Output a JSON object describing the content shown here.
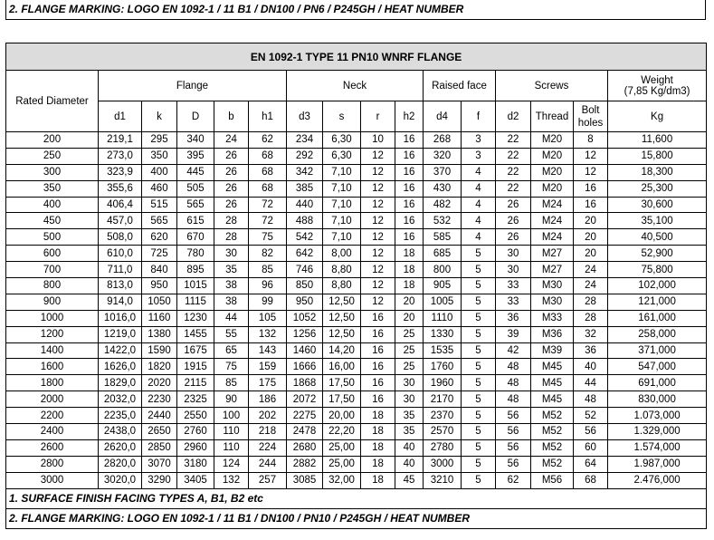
{
  "top_note": "2. FLANGE MARKING: LOGO EN 1092-1 / 11 B1 / DN100 / PN6 / P245GH / HEAT NUMBER",
  "table": {
    "title": "EN 1092-1 TYPE 11 PN10 WNRF FLANGE",
    "groups": {
      "rated": "Rated Diameter",
      "flange": "Flange",
      "neck": "Neck",
      "raised_face": "Raised face",
      "screws": "Screws",
      "weight_line1": "Weight",
      "weight_line2": "(7,85 Kg/dm3)"
    },
    "subheaders": [
      "d1",
      "k",
      "D",
      "b",
      "h1",
      "d3",
      "s",
      "r",
      "h2",
      "d4",
      "f",
      "d2",
      "Thread",
      "Bolt holes",
      "Kg"
    ],
    "rows": [
      [
        "200",
        "219,1",
        "295",
        "340",
        "24",
        "62",
        "234",
        "6,30",
        "10",
        "16",
        "268",
        "3",
        "22",
        "M20",
        "8",
        "11,600"
      ],
      [
        "250",
        "273,0",
        "350",
        "395",
        "26",
        "68",
        "292",
        "6,30",
        "12",
        "16",
        "320",
        "3",
        "22",
        "M20",
        "12",
        "15,800"
      ],
      [
        "300",
        "323,9",
        "400",
        "445",
        "26",
        "68",
        "342",
        "7,10",
        "12",
        "16",
        "370",
        "4",
        "22",
        "M20",
        "12",
        "18,300"
      ],
      [
        "350",
        "355,6",
        "460",
        "505",
        "26",
        "68",
        "385",
        "7,10",
        "12",
        "16",
        "430",
        "4",
        "22",
        "M20",
        "16",
        "25,300"
      ],
      [
        "400",
        "406,4",
        "515",
        "565",
        "26",
        "72",
        "440",
        "7,10",
        "12",
        "16",
        "482",
        "4",
        "26",
        "M24",
        "16",
        "30,600"
      ],
      [
        "450",
        "457,0",
        "565",
        "615",
        "28",
        "72",
        "488",
        "7,10",
        "12",
        "16",
        "532",
        "4",
        "26",
        "M24",
        "20",
        "35,100"
      ],
      [
        "500",
        "508,0",
        "620",
        "670",
        "28",
        "75",
        "542",
        "7,10",
        "12",
        "16",
        "585",
        "4",
        "26",
        "M24",
        "20",
        "40,500"
      ],
      [
        "600",
        "610,0",
        "725",
        "780",
        "30",
        "82",
        "642",
        "8,00",
        "12",
        "18",
        "685",
        "5",
        "30",
        "M27",
        "20",
        "52,900"
      ],
      [
        "700",
        "711,0",
        "840",
        "895",
        "35",
        "85",
        "746",
        "8,80",
        "12",
        "18",
        "800",
        "5",
        "30",
        "M27",
        "24",
        "75,800"
      ],
      [
        "800",
        "813,0",
        "950",
        "1015",
        "38",
        "96",
        "850",
        "8,80",
        "12",
        "18",
        "905",
        "5",
        "33",
        "M30",
        "24",
        "102,000"
      ],
      [
        "900",
        "914,0",
        "1050",
        "1115",
        "38",
        "99",
        "950",
        "12,50",
        "12",
        "20",
        "1005",
        "5",
        "33",
        "M30",
        "28",
        "121,000"
      ],
      [
        "1000",
        "1016,0",
        "1160",
        "1230",
        "44",
        "105",
        "1052",
        "12,50",
        "16",
        "20",
        "1110",
        "5",
        "36",
        "M33",
        "28",
        "161,000"
      ],
      [
        "1200",
        "1219,0",
        "1380",
        "1455",
        "55",
        "132",
        "1256",
        "12,50",
        "16",
        "25",
        "1330",
        "5",
        "39",
        "M36",
        "32",
        "258,000"
      ],
      [
        "1400",
        "1422,0",
        "1590",
        "1675",
        "65",
        "143",
        "1460",
        "14,20",
        "16",
        "25",
        "1535",
        "5",
        "42",
        "M39",
        "36",
        "371,000"
      ],
      [
        "1600",
        "1626,0",
        "1820",
        "1915",
        "75",
        "159",
        "1666",
        "16,00",
        "16",
        "25",
        "1760",
        "5",
        "48",
        "M45",
        "40",
        "547,000"
      ],
      [
        "1800",
        "1829,0",
        "2020",
        "2115",
        "85",
        "175",
        "1868",
        "17,50",
        "16",
        "30",
        "1960",
        "5",
        "48",
        "M45",
        "44",
        "691,000"
      ],
      [
        "2000",
        "2032,0",
        "2230",
        "2325",
        "90",
        "186",
        "2072",
        "17,50",
        "16",
        "30",
        "2170",
        "5",
        "48",
        "M45",
        "48",
        "830,000"
      ],
      [
        "2200",
        "2235,0",
        "2440",
        "2550",
        "100",
        "202",
        "2275",
        "20,00",
        "18",
        "35",
        "2370",
        "5",
        "56",
        "M52",
        "52",
        "1.073,000"
      ],
      [
        "2400",
        "2438,0",
        "2650",
        "2760",
        "110",
        "218",
        "2478",
        "22,20",
        "18",
        "35",
        "2570",
        "5",
        "56",
        "M52",
        "56",
        "1.329,000"
      ],
      [
        "2600",
        "2620,0",
        "2850",
        "2960",
        "110",
        "224",
        "2680",
        "25,00",
        "18",
        "40",
        "2780",
        "5",
        "56",
        "M52",
        "60",
        "1.574,000"
      ],
      [
        "2800",
        "2820,0",
        "3070",
        "3180",
        "124",
        "244",
        "2882",
        "25,00",
        "18",
        "40",
        "3000",
        "5",
        "56",
        "M52",
        "64",
        "1.987,000"
      ],
      [
        "3000",
        "3020,0",
        "3290",
        "3405",
        "132",
        "257",
        "3085",
        "32,00",
        "18",
        "45",
        "3210",
        "5",
        "62",
        "M56",
        "68",
        "2.476,000"
      ]
    ],
    "footnotes": [
      "1. SURFACE FINISH FACING TYPES A, B1, B2 etc",
      "2. FLANGE MARKING: LOGO EN 1092-1 / 11 B1 / DN100 / PN10 / P245GH / HEAT NUMBER"
    ]
  }
}
